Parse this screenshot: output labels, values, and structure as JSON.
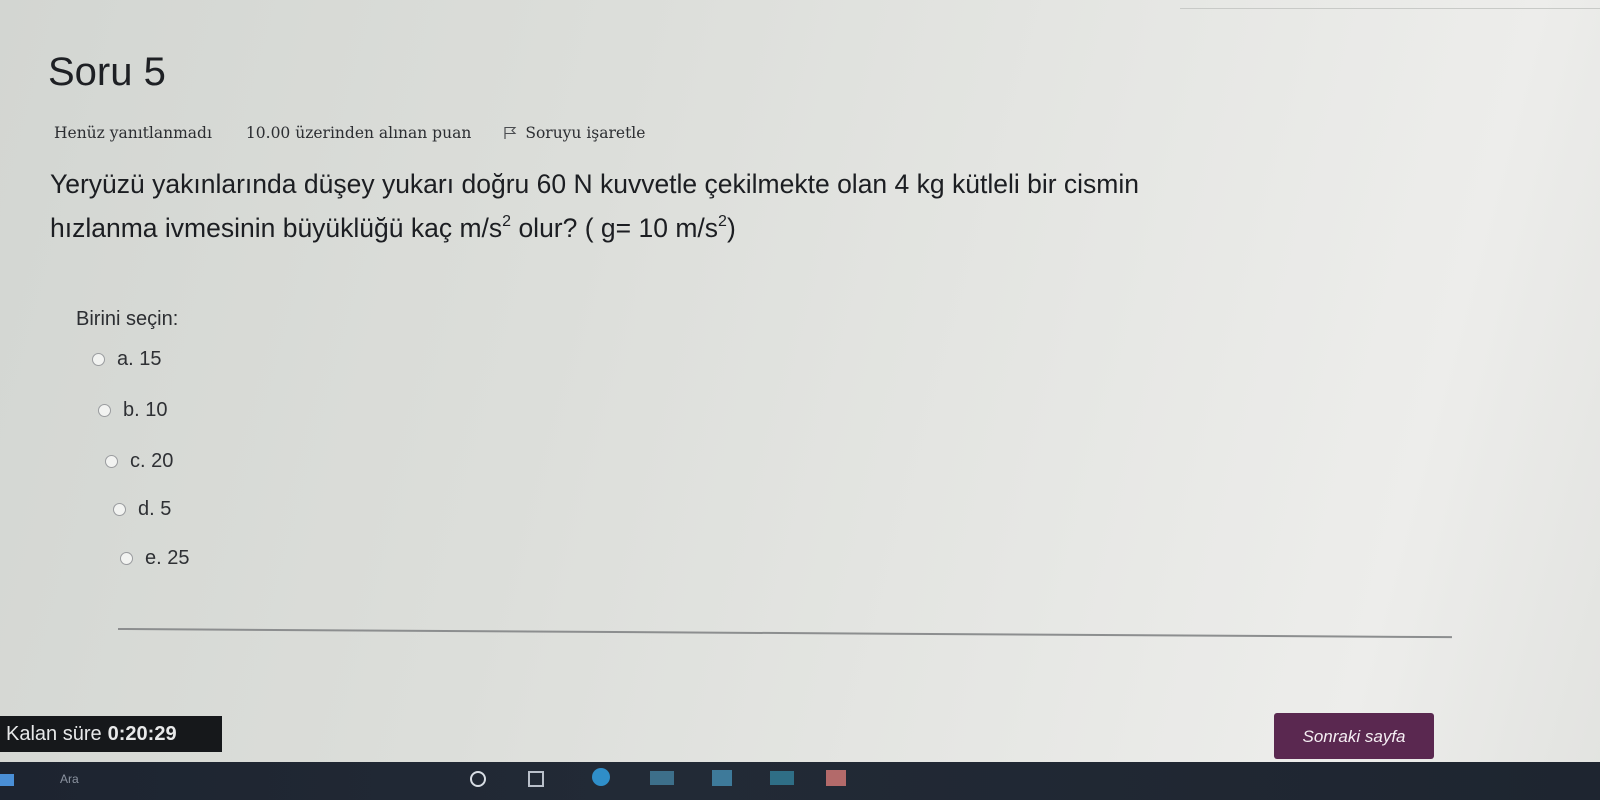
{
  "question": {
    "title": "Soru 5",
    "status": "Henüz yanıtlanmadı",
    "points": "10.00 üzerinden alınan puan",
    "flag_label": "Soruyu işaretle",
    "text_line1": "Yeryüzü yakınlarında düşey yukarı doğru 60 N kuvvetle çekilmekte olan 4 kg kütleli bir cismin",
    "text_line2_a": "hızlanma ivmesinin büyüklüğü kaç m/s",
    "text_line2_sup1": "2",
    "text_line2_b": " olur? ( g= 10 m/s",
    "text_line2_sup2": "2",
    "text_line2_c": ")"
  },
  "answers": {
    "prompt": "Birini seçin:",
    "options": [
      {
        "label": "a. 15"
      },
      {
        "label": "b. 10"
      },
      {
        "label": "c. 20"
      },
      {
        "label": "d. 5"
      },
      {
        "label": "e. 25"
      }
    ]
  },
  "footer": {
    "timer_label": "Kalan süre",
    "timer_value": "0:20:29",
    "next_button": "Sonraki sayfa"
  },
  "taskbar": {
    "search_placeholder": "Ara"
  },
  "colors": {
    "next_button_bg": "#5a2850",
    "timer_bg": "#16181b",
    "taskbar_bg": "#1f2631"
  }
}
